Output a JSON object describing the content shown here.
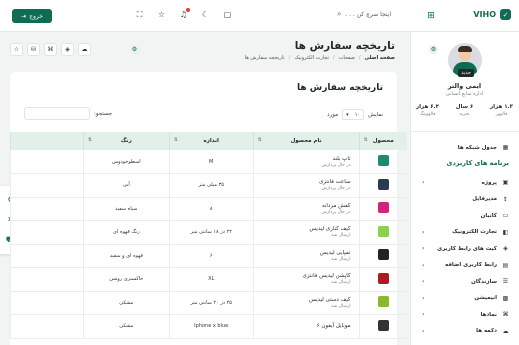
{
  "topbar": {
    "logo": "VIHO",
    "search_placeholder": "اینجا سرچ کن . . .",
    "logout_label": "خروج",
    "icons": [
      "maximize-icon",
      "star-icon",
      "bell-icon",
      "moon-icon",
      "chat-icon",
      "messages-icon"
    ]
  },
  "profile": {
    "badge": "جدید",
    "name": "ایمی والتر",
    "role": "اداره منابع انسانی",
    "stats": [
      {
        "value": "۱.۳ هزار",
        "label": "فالوور"
      },
      {
        "value": "۶ سال",
        "label": "تجربه"
      },
      {
        "value": "۶.۴ هزار",
        "label": "فالووینگ"
      }
    ]
  },
  "sidebar": {
    "items_top": [
      {
        "label": "جدول شبکه ها",
        "icon": "grid-icon"
      }
    ],
    "section_title": "برنامه های کاربردی",
    "items": [
      {
        "label": "پروژه",
        "icon": "box-icon",
        "chevron": true
      },
      {
        "label": "مدیرفایل",
        "icon": "upload-icon",
        "chevron": false
      },
      {
        "label": "کانبان",
        "icon": "monitor-icon",
        "chevron": false
      },
      {
        "label": "تجارت الکترونیک",
        "icon": "bag-icon",
        "chevron": true
      },
      {
        "label": "کیت های رابط کاربری",
        "icon": "layers-icon",
        "chevron": true
      },
      {
        "label": "رابط کاربری اضافه",
        "icon": "folder-icon",
        "chevron": true
      },
      {
        "label": "سازندگان",
        "icon": "sliders-icon",
        "chevron": true
      },
      {
        "label": "انیمیشن",
        "icon": "cpu-icon",
        "chevron": true
      },
      {
        "label": "نمادها",
        "icon": "command-icon",
        "chevron": true
      },
      {
        "label": "دکمه ها",
        "icon": "cloud-icon",
        "chevron": true
      }
    ]
  },
  "page": {
    "title": "تاریخچه سفارش ها",
    "breadcrumb": [
      "صفحه اصلی",
      "صفحات",
      "تجارت الکترونیک",
      "تاریخچه سفارش ها"
    ]
  },
  "card": {
    "title": "تاریخچه سفارش ها",
    "show_label": "نمایش",
    "show_value": "۱۰",
    "entries_label": "مورد",
    "search_label": "جستجو:"
  },
  "table": {
    "columns": [
      "محصول",
      "نام محصول",
      "اندازه",
      "رنگ",
      ""
    ],
    "rows": [
      {
        "color": "#1f8a70",
        "name": "تاپ بلند",
        "status": "در حال پردازش",
        "size": "M",
        "tone": "اسطوخودوس"
      },
      {
        "color": "#2b3a55",
        "name": "ساعت فانتزی",
        "status": "در حال پردازش",
        "size": "۳۵ میلی متر",
        "tone": "آبی"
      },
      {
        "color": "#d0237f",
        "name": "کفش مردانه",
        "status": "در حال پردازش",
        "size": "۸",
        "tone": "سیاه سفید"
      },
      {
        "color": "#8bd14a",
        "name": "کیف کناری لیدیس",
        "status": "ارسال شد",
        "size": "۲۲ در ۱۸ سانتی متر",
        "tone": "رنگ قهوه ای"
      },
      {
        "color": "#222222",
        "name": "تمپایی لیدیس",
        "status": "ارسال شد",
        "size": "۶",
        "tone": "قهوه ای و سفید"
      },
      {
        "color": "#b0191e",
        "name": "کاپشن لیدیس فانتزی",
        "status": "ارسال شد",
        "size": "XL",
        "tone": "خاکستری روشن"
      },
      {
        "color": "#8ab82e",
        "name": "کیف دستی لیدیس",
        "status": "ارسال شد",
        "size": "۲۵ در ۲۰ سانتی متر",
        "tone": "مشکی"
      },
      {
        "color": "#333333",
        "name": "موبایل آیفون ۶",
        "status": "",
        "size": "Iphone x blue",
        "tone": "مشکی"
      }
    ]
  },
  "floaters": [
    "gear-icon",
    "settings-icon",
    "truck-icon"
  ]
}
